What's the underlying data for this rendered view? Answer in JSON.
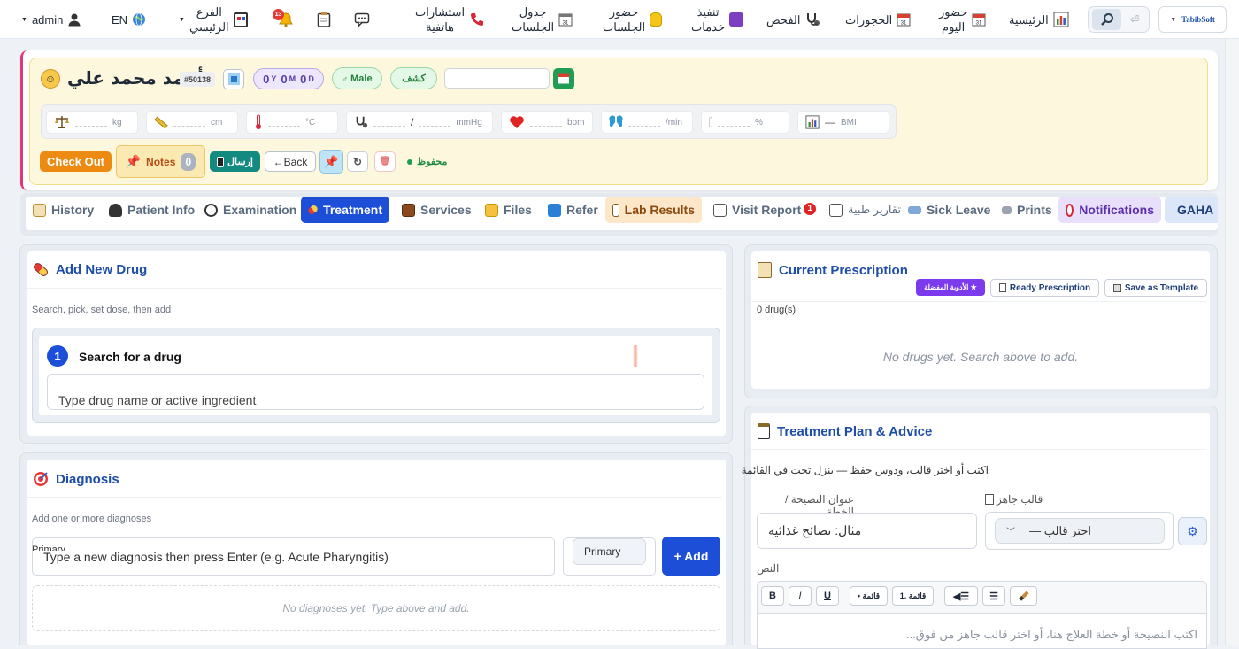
{
  "nav": {
    "brand": "TabibSoft",
    "home": "الرئيسية",
    "today_attendance": [
      "حضور",
      "اليوم"
    ],
    "bookings": "الحجوزات",
    "exams": "الفحص",
    "services_exec": [
      "تنفيذ",
      "خدمات"
    ],
    "session_attendance": [
      "حضور",
      "الجلسات"
    ],
    "sessions_schedule": [
      "جدول",
      "الجلسات"
    ],
    "phone_consult": [
      "استشارات",
      "هاتفية"
    ],
    "bell_badge": "13",
    "branch": [
      "الفرع",
      "الرئيسي"
    ],
    "lang": "EN",
    "user": "admin"
  },
  "patient": {
    "name": "أحمد محمد علي",
    "id": "#50138",
    "age": {
      "y": "0",
      "y_unit": "Y",
      "m": "0",
      "m_unit": "M",
      "d": "0",
      "d_unit": "D"
    },
    "gender": "Male",
    "visit_type": "كشف",
    "date_value": ""
  },
  "vitals": {
    "weight_unit": "kg",
    "height_unit": "cm",
    "temp_unit": "°C",
    "bp_sep": "/",
    "bp_unit": "mmHg",
    "pulse_unit": "bpm",
    "resp_unit": "/min",
    "spo2_unit": "%",
    "bmi_value": "—",
    "bmi_label": "BMI"
  },
  "actions": {
    "checkout": "Check Out",
    "notes": "Notes",
    "notes_count": "0",
    "send": "إرسال",
    "back": "←Back",
    "saved": "محفوظ"
  },
  "tabs": [
    {
      "label": "History"
    },
    {
      "label": "Patient Info"
    },
    {
      "label": "Examination"
    },
    {
      "label": "Treatment"
    },
    {
      "label": "Services"
    },
    {
      "label": "Files"
    },
    {
      "label": "Refer"
    },
    {
      "label": "Lab Results"
    },
    {
      "label": "Visit Report",
      "badge": "1"
    },
    {
      "label": "تقارير طبية"
    },
    {
      "label": "Sick Leave"
    },
    {
      "label": "Prints"
    },
    {
      "label": "Notifications"
    },
    {
      "label": "GAHA"
    }
  ],
  "add_drug": {
    "title": "Add New Drug",
    "subtitle": "Search, pick, set dose, then add",
    "step_num": "1",
    "step_title": "Search for a drug",
    "search_placeholder": "Type drug name or active ingredient"
  },
  "diagnosis": {
    "title": "Diagnosis",
    "subtitle": "Add one or more diagnoses",
    "primary_hint": "Primary",
    "input_placeholder": "Type a new diagnosis then press Enter (e.g. Acute Pharyngitis)",
    "type_selected": "Primary",
    "add_button": "+ Add",
    "empty": "No diagnoses yet. Type above and add."
  },
  "prescription": {
    "title": "Current Prescription",
    "fav_btn": "الأدوية المفضلة ★",
    "ready_btn": "Ready Prescription",
    "save_btn": "Save as Template",
    "count": "0 drug(s)",
    "empty": "No drugs yet. Search above to add."
  },
  "plan": {
    "title": "Treatment Plan & Advice",
    "hint": "اكتب أو اختر قالب، ودوس حفظ — ينزل تحت في القائمة",
    "advice_title_label": "عنوان النصيحة / الخطة",
    "advice_title_placeholder": "مثال: نصائح غذائية",
    "template_label": "قالب جاهز",
    "template_select": "— اختر قالب",
    "text_label": "النص",
    "toolbar": {
      "bold": "B",
      "italic": "I",
      "underline": "U",
      "bullet": "• قائمة",
      "numbered": "1. قائمة"
    },
    "editor_placeholder": "اكتب النصيحة أو خطة العلاج هنا، أو اختر قالب جاهز من فوق..."
  }
}
